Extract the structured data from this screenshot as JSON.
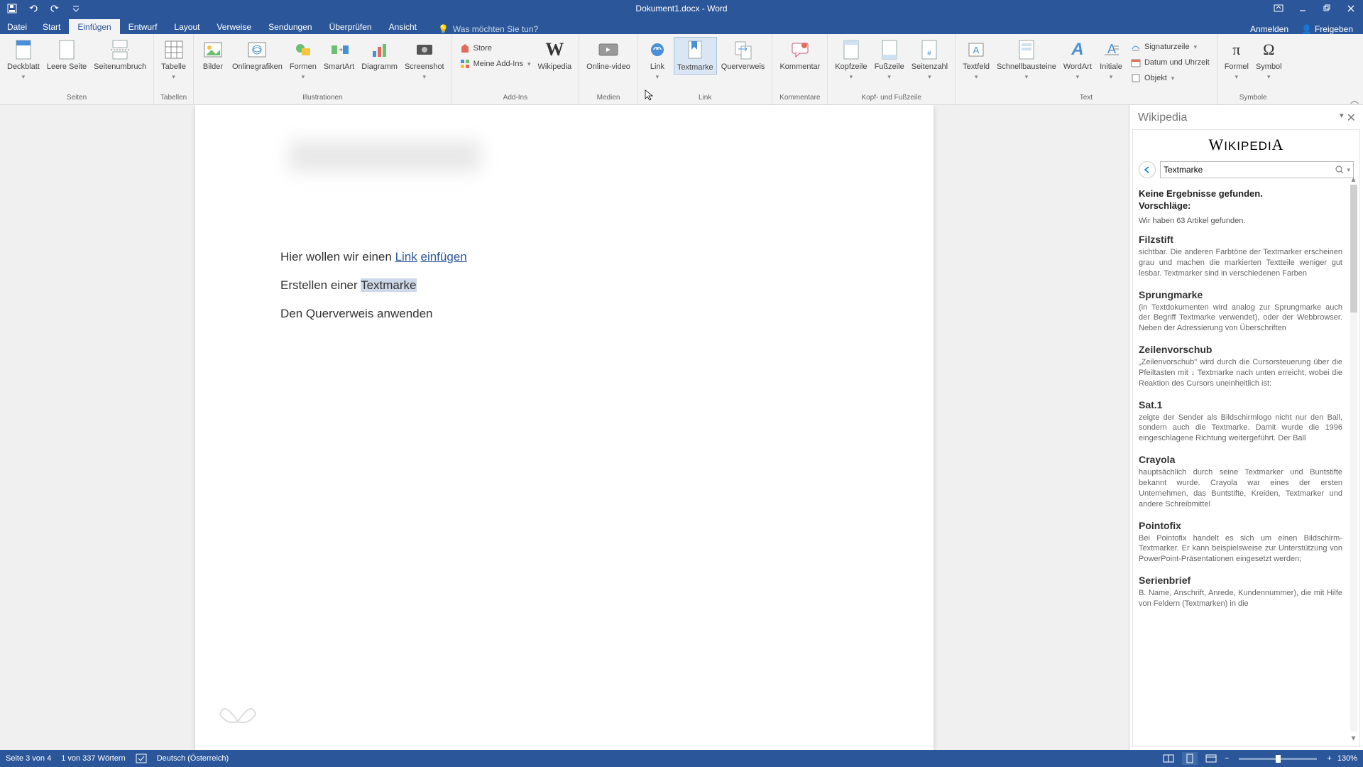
{
  "title": "Dokument1.docx - Word",
  "tabs": {
    "file": "Datei",
    "home": "Start",
    "insert": "Einfügen",
    "design": "Entwurf",
    "layout": "Layout",
    "references": "Verweise",
    "mailings": "Sendungen",
    "review": "Überprüfen",
    "view": "Ansicht",
    "tellme": "Was möchten Sie tun?",
    "signin": "Anmelden",
    "share": "Freigeben"
  },
  "ribbon": {
    "pages": {
      "cover": "Deckblatt",
      "blank": "Leere Seite",
      "break": "Seitenumbruch",
      "group": "Seiten"
    },
    "tables": {
      "table": "Tabelle",
      "group": "Tabellen"
    },
    "illustrations": {
      "pictures": "Bilder",
      "online": "Onlinegrafiken",
      "shapes": "Formen",
      "smartart": "SmartArt",
      "chart": "Diagramm",
      "screenshot": "Screenshot",
      "group": "Illustrationen"
    },
    "addins": {
      "store": "Store",
      "myaddins": "Meine Add-Ins",
      "wikipedia": "Wikipedia",
      "group": "Add-Ins"
    },
    "media": {
      "video": "Online-video",
      "group": "Medien"
    },
    "links": {
      "link": "Link",
      "bookmark": "Textmarke",
      "crossref": "Querverweis",
      "group": "Link"
    },
    "comments": {
      "comment": "Kommentar",
      "group": "Kommentare"
    },
    "headerfooter": {
      "header": "Kopfzeile",
      "footer": "Fußzeile",
      "pageno": "Seitenzahl",
      "group": "Kopf- und Fußzeile"
    },
    "text": {
      "textbox": "Textfeld",
      "quickparts": "Schnellbausteine",
      "wordart": "WordArt",
      "dropcap": "Initiale",
      "sigline": "Signaturzeile",
      "datetime": "Datum und Uhrzeit",
      "object": "Objekt",
      "group": "Text"
    },
    "symbols": {
      "equation": "Formel",
      "symbol": "Symbol",
      "group": "Symbole"
    }
  },
  "document": {
    "line1_pre": "Hier wollen wir einen ",
    "line1_link": "Link",
    "line1_mid": " ",
    "line1_link2": "einfügen",
    "line2_pre": "Erstellen einer ",
    "line2_sel": "Textmarke",
    "line3": "Den Querverweis anwenden"
  },
  "wikipedia": {
    "pane_title": "Wikipedia",
    "logo": "WIKIPEDIA",
    "search_value": "Textmarke",
    "no_results": "Keine Ergebnisse gefunden.",
    "suggestions": "Vorschläge:",
    "count": "Wir haben 63 Artikel gefunden.",
    "entries": [
      {
        "title": "Filzstift",
        "snippet": "sichtbar. Die anderen Farbtöne der Textmarker erscheinen grau und machen die markierten Textteile weniger gut lesbar. Textmarker sind in verschiedenen Farben"
      },
      {
        "title": "Sprungmarke",
        "snippet": "(in Textdokumenten wird analog zur Sprungmarke auch der Begriff Textmarke verwendet), oder der Webbrowser. Neben der Adressierung von Überschriften"
      },
      {
        "title": "Zeilenvorschub",
        "snippet": "„Zeilenvorschub\" wird durch die Cursorsteuerung über die Pfeiltasten mit ↓ Textmarke nach unten erreicht, wobei die Reaktion des Cursors uneinheitlich ist:"
      },
      {
        "title": "Sat.1",
        "snippet": "zeigte der Sender als Bildschirmlogo nicht nur den Ball, sondern auch die Textmarke. Damit wurde die 1996 eingeschlagene Richtung weitergeführt. Der Ball"
      },
      {
        "title": "Crayola",
        "snippet": "hauptsächlich durch seine Textmarker und Buntstifte bekannt wurde. Crayola war eines der ersten Unternehmen, das Buntstifte, Kreiden, Textmarker und andere Schreibmittel"
      },
      {
        "title": "Pointofix",
        "snippet": "Bei Pointofix handelt es sich um einen Bildschirm-Textmarker. Er kann beispielsweise zur Unterstützung von PowerPoint-Präsentationen eingesetzt werden;"
      },
      {
        "title": "Serienbrief",
        "snippet": "B. Name, Anschrift, Anrede, Kundennummer), die mit Hilfe von Feldern (Textmarken) in die"
      }
    ]
  },
  "status": {
    "page": "Seite 3 von 4",
    "words": "1 von 337 Wörtern",
    "lang": "Deutsch (Österreich)",
    "zoom": "130%"
  }
}
